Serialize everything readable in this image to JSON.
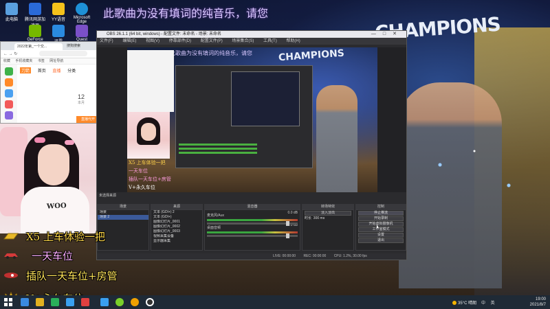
{
  "desktop": {
    "banner": "此歌曲为没有填词的纯音乐，请您",
    "bg_text": "CHAMPIONS",
    "icons": [
      {
        "label": "此电脑",
        "color": "#5aa0e0"
      },
      {
        "label": "腾讯网游加速器",
        "color": "#2a6ad8"
      },
      {
        "label": "YY语音",
        "color": "#f5c21b"
      },
      {
        "label": "Microsoft Edge",
        "color": "#1e90d6"
      },
      {
        "label": "GeForce",
        "color": "#76b900"
      },
      {
        "label": "迅雷",
        "color": "#2a8ae0"
      },
      {
        "label": "Quest",
        "color": "#7a50c8"
      }
    ]
  },
  "browser": {
    "tab_title": "2022年第_一个交...",
    "tab_title2": "搜狗搜索",
    "address": "",
    "bookmarks": [
      "收藏",
      "手机收藏夹",
      "书签",
      "网址导航"
    ],
    "nav": [
      "首页",
      "直播",
      "分类"
    ],
    "logo": "刀箭",
    "stat_value": "12",
    "stat_label": "本月",
    "action_label": "直播代开",
    "side_icons": [
      "#3fb24a",
      "#ff8a2a",
      "#4aa0f0",
      "#f25a5a",
      "#8a6ae0"
    ]
  },
  "obs": {
    "title": "OBS 26.1.1 (64 bit, windows) - 配置文件: 未命名 - 场景: 未命名",
    "menu": [
      "文件(F)",
      "编辑(E)",
      "视图(V)",
      "停靠部件(D)",
      "配置文件(P)",
      "场景集合(S)",
      "工具(T)",
      "帮助(H)"
    ],
    "docks": {
      "scenes_title": "场景",
      "sources_title": "来源",
      "mixer_title": "混音器",
      "transitions_title": "转场特效",
      "controls_title": "控制",
      "side_label": "未选择来源",
      "scenes": [
        "场景",
        "场景 2"
      ],
      "sources": [
        "文本 (GDI+) 2",
        "文本 (GDI+)",
        "图像幻灯片_0001",
        "图像幻灯片_0002",
        "图像幻灯片_0003",
        "视频采集设备",
        "显示器采集"
      ],
      "mixer": [
        {
          "name": "麦克风/Aux",
          "db": "0.0 dB"
        },
        {
          "name": "桌面音频",
          "db": "0.0 dB"
        }
      ],
      "transition": "淡入淡出",
      "duration_label": "时长",
      "duration": "300 ms",
      "controls": [
        "停止推流",
        "开始录制",
        "开始虚拟摄像机",
        "工作室模式",
        "设置",
        "退出"
      ]
    },
    "status": [
      "LIVE: 00:00:00",
      "REC: 00:00:00",
      "CPU: 1.2%, 30.00 fps"
    ]
  },
  "overlay": {
    "tags": [
      "X5 上车体验一把",
      "一天车位",
      "插队一天车位+房管",
      "V+永久车位"
    ],
    "tag_colors": [
      "#ffd84a",
      "#ffb0ff",
      "#ffe45a",
      "#ffe45a"
    ],
    "preview_tags": [
      "X5 上车体验一把",
      "一天车位",
      "插队一天车位+房管",
      "V+永久车位"
    ],
    "webcam_shirt": "WOO"
  },
  "taskbar": {
    "weather": "35°C 晴朗",
    "tray": "中 英",
    "time": "19:00",
    "date": "2021/8/7",
    "icon_colors": [
      "#ffffff",
      "#3a8ae0",
      "#e0b020",
      "#2ab05a",
      "#3aa0f0",
      "#e04040",
      "#7ad02a",
      "#f0a000",
      "#ffffff"
    ]
  }
}
